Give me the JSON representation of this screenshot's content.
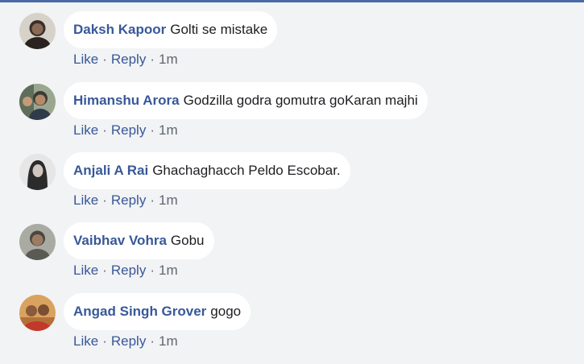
{
  "actions": {
    "like": "Like",
    "reply": "Reply",
    "separator": "·"
  },
  "comments": [
    {
      "author": "Daksh Kapoor",
      "text": "Golti se mistake",
      "time": "1m",
      "avatar_icon": "user-avatar",
      "avatar_color": "#3a2f2a"
    },
    {
      "author": "Himanshu Arora",
      "text": "Godzilla godra gomutra goKaran majhi",
      "time": "1m",
      "avatar_icon": "user-avatar",
      "avatar_color": "#6b7a66"
    },
    {
      "author": "Anjali A Rai",
      "text": "Ghachaghacch Peldo Escobar.",
      "time": "1m",
      "avatar_icon": "user-avatar",
      "avatar_color": "#d9d9d9"
    },
    {
      "author": "Vaibhav Vohra",
      "text": "Gobu",
      "time": "1m",
      "avatar_icon": "user-avatar",
      "avatar_color": "#8a8c86"
    },
    {
      "author": "Angad Singh Grover",
      "text": "gogo",
      "time": "1m",
      "avatar_icon": "user-avatar",
      "avatar_color": "#c58a4e"
    }
  ]
}
